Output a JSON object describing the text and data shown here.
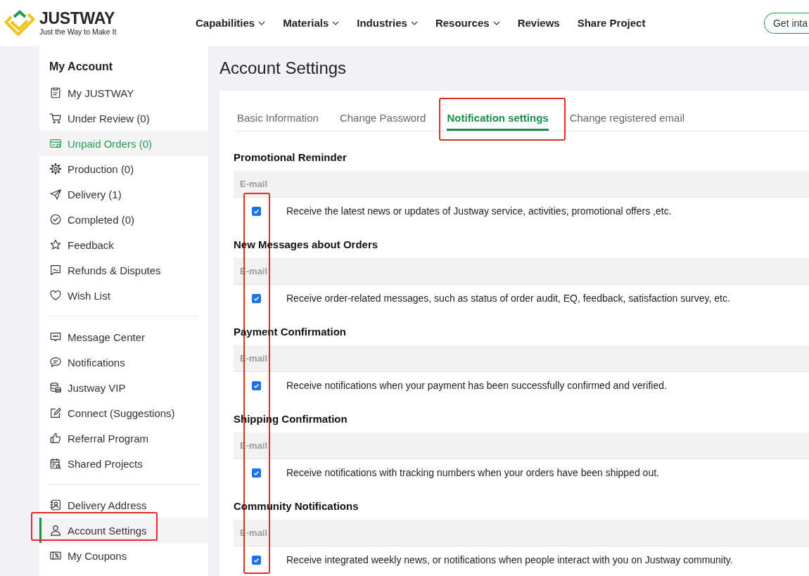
{
  "header": {
    "logo": {
      "name": "JUSTWAY",
      "tagline": "Just the Way to Make It"
    },
    "nav": [
      {
        "label": "Capabilities",
        "dropdown": true
      },
      {
        "label": "Materials",
        "dropdown": true
      },
      {
        "label": "Industries",
        "dropdown": true
      },
      {
        "label": "Resources",
        "dropdown": true
      },
      {
        "label": "Reviews",
        "dropdown": false
      },
      {
        "label": "Share Project",
        "dropdown": false
      }
    ],
    "cta": "Get inta"
  },
  "sidebar": {
    "title": "My Account",
    "groups": [
      {
        "items": [
          {
            "label": "My JUSTWAY",
            "selected": false,
            "hovered": false,
            "highlighted": false
          },
          {
            "label": "Under Review (0)",
            "selected": false,
            "hovered": false,
            "highlighted": false
          },
          {
            "label": "Unpaid Orders (0)",
            "selected": false,
            "hovered": true,
            "highlighted": false
          },
          {
            "label": "Production (0)",
            "selected": false,
            "hovered": false,
            "highlighted": false
          },
          {
            "label": "Delivery (1)",
            "selected": false,
            "hovered": false,
            "highlighted": false
          },
          {
            "label": "Completed (0)",
            "selected": false,
            "hovered": false,
            "highlighted": false
          },
          {
            "label": "Feedback",
            "selected": false,
            "hovered": false,
            "highlighted": false
          },
          {
            "label": "Refunds & Disputes",
            "selected": false,
            "hovered": false,
            "highlighted": false
          },
          {
            "label": "Wish List",
            "selected": false,
            "hovered": false,
            "highlighted": false
          }
        ]
      },
      {
        "items": [
          {
            "label": "Message Center",
            "selected": false,
            "hovered": false,
            "highlighted": false
          },
          {
            "label": "Notifications",
            "selected": false,
            "hovered": false,
            "highlighted": false
          },
          {
            "label": "Justway VIP",
            "selected": false,
            "hovered": false,
            "highlighted": false
          },
          {
            "label": "Connect (Suggestions)",
            "selected": false,
            "hovered": false,
            "highlighted": false
          },
          {
            "label": "Referral Program",
            "selected": false,
            "hovered": false,
            "highlighted": false
          },
          {
            "label": "Shared Projects",
            "selected": false,
            "hovered": false,
            "highlighted": false
          }
        ]
      },
      {
        "items": [
          {
            "label": "Delivery Address",
            "selected": false,
            "hovered": false,
            "highlighted": false
          },
          {
            "label": "Account Settings",
            "selected": true,
            "hovered": false,
            "highlighted": true
          },
          {
            "label": "My Coupons",
            "selected": false,
            "hovered": false,
            "highlighted": false
          }
        ]
      }
    ]
  },
  "page_title": "Account Settings",
  "tabs": [
    {
      "label": "Basic Information",
      "selected": false,
      "highlighted": false
    },
    {
      "label": "Change Password",
      "selected": false,
      "highlighted": false
    },
    {
      "label": "Notification settings",
      "selected": true,
      "highlighted": true
    },
    {
      "label": "Change registered email",
      "selected": false,
      "highlighted": false
    }
  ],
  "notification_settings": {
    "checkbox_column_highlighted": true,
    "sections": [
      {
        "title": "Promotional Reminder",
        "channel": "E-mail",
        "checked": true,
        "description": "Receive the latest news or updates of Justway service, activities, promotional offers ,etc."
      },
      {
        "title": "New Messages about Orders",
        "channel": "E-mail",
        "checked": true,
        "description": "Receive order-related messages, such as status of order audit, EQ, feedback, satisfaction survey, etc."
      },
      {
        "title": "Payment Confirmation",
        "channel": "E-mail",
        "checked": true,
        "description": "Receive notifications when your payment has been successfully confirmed and verified."
      },
      {
        "title": "Shipping Confirmation",
        "channel": "E-mail",
        "checked": true,
        "description": "Receive notifications with tracking numbers when your orders have been shipped out."
      },
      {
        "title": "Community Notifications",
        "channel": "E-mail",
        "checked": true,
        "description": "Receive integrated weekly news, or notifications when people interact with you on Justway community."
      }
    ]
  }
}
